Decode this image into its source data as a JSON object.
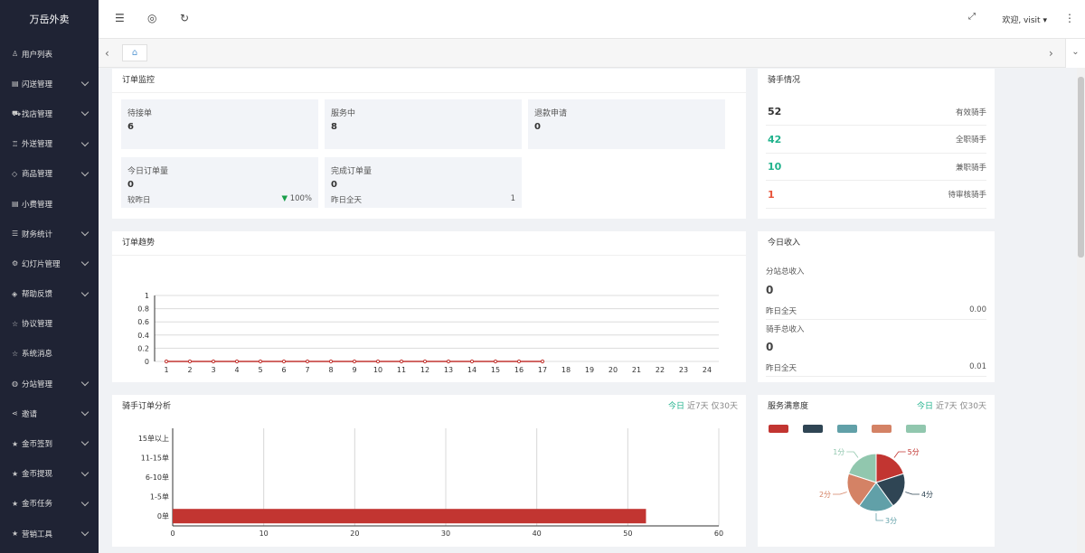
{
  "app": {
    "title": "万岳外卖"
  },
  "sidebar": {
    "items": [
      {
        "label": "用户列表",
        "icon": "user-icon",
        "glyph": "♙",
        "chevron": false
      },
      {
        "label": "闪送管理",
        "icon": "document-icon",
        "glyph": "▤",
        "chevron": true
      },
      {
        "label": "找店管理",
        "icon": "car-icon",
        "glyph": "⛟",
        "chevron": true
      },
      {
        "label": "外送管理",
        "icon": "courier-icon",
        "glyph": "♖",
        "chevron": true
      },
      {
        "label": "商品管理",
        "icon": "diamond-icon",
        "glyph": "◇",
        "chevron": true
      },
      {
        "label": "小费管理",
        "icon": "document-icon",
        "glyph": "▤",
        "chevron": false
      },
      {
        "label": "财务统计",
        "icon": "list-icon",
        "glyph": "☰",
        "chevron": true
      },
      {
        "label": "幻灯片管理",
        "icon": "gear-icon",
        "glyph": "⚙",
        "chevron": true
      },
      {
        "label": "帮助反馈",
        "icon": "layers-icon",
        "glyph": "◈",
        "chevron": true
      },
      {
        "label": "协议管理",
        "icon": "star-outline-icon",
        "glyph": "☆",
        "chevron": false
      },
      {
        "label": "系统消息",
        "icon": "star-outline-icon",
        "glyph": "☆",
        "chevron": false
      },
      {
        "label": "分站管理",
        "icon": "globe-icon",
        "glyph": "◍",
        "chevron": true
      },
      {
        "label": "邀请",
        "icon": "share-icon",
        "glyph": "⋖",
        "chevron": true
      },
      {
        "label": "金币签到",
        "icon": "star-icon",
        "glyph": "★",
        "chevron": true
      },
      {
        "label": "金币提现",
        "icon": "star-icon",
        "glyph": "★",
        "chevron": true
      },
      {
        "label": "金币任务",
        "icon": "star-icon",
        "glyph": "★",
        "chevron": true
      },
      {
        "label": "营销工具",
        "icon": "star-icon",
        "glyph": "★",
        "chevron": true
      }
    ]
  },
  "header": {
    "welcome": "欢迎, visit",
    "icons": [
      "menu-fold-icon",
      "globe-icon",
      "refresh-icon",
      "fullscreen-icon",
      "more-icon"
    ]
  },
  "order_monitor": {
    "title": "订单监控",
    "stats": [
      {
        "label": "待接单",
        "value": "6"
      },
      {
        "label": "服务中",
        "value": "8"
      },
      {
        "label": "退款申请",
        "value": "0"
      }
    ],
    "today": {
      "label": "今日订单量",
      "value": "0",
      "compare_label": "较昨日",
      "compare_value": "100%"
    },
    "completed": {
      "label": "完成订单量",
      "value": "0",
      "yesterday_label": "昨日全天",
      "yesterday_value": "1"
    }
  },
  "riders": {
    "title": "骑手情况",
    "rows": [
      {
        "count": "52",
        "label": "有效骑手",
        "color": "#333333"
      },
      {
        "count": "42",
        "label": "全职骑手",
        "color": "#20b28c"
      },
      {
        "count": "10",
        "label": "兼职骑手",
        "color": "#20b28c"
      },
      {
        "count": "1",
        "label": "待审核骑手",
        "color": "#e8543a"
      }
    ]
  },
  "income": {
    "title": "今日收入",
    "station_label": "分站总收入",
    "station_value": "0",
    "station_yesterday_label": "昨日全天",
    "station_yesterday_value": "0.00",
    "rider_label": "骑手总收入",
    "rider_value": "0",
    "rider_yesterday_label": "昨日全天",
    "rider_yesterday_value": "0.01"
  },
  "trend": {
    "title": "订单趋势"
  },
  "rider_orders": {
    "title": "骑手订单分析",
    "filters": [
      "今日",
      "近7天",
      "仅30天"
    ]
  },
  "satisfaction": {
    "title": "服务满意度",
    "filters": [
      "今日",
      "近7天",
      "仅30天"
    ]
  },
  "chart_data": [
    {
      "type": "line",
      "x": [
        "1",
        "2",
        "3",
        "4",
        "5",
        "6",
        "7",
        "8",
        "9",
        "10",
        "11",
        "12",
        "13",
        "14",
        "15",
        "16",
        "17",
        "18",
        "19",
        "20",
        "21",
        "22",
        "23",
        "24"
      ],
      "series": [
        {
          "values": [
            0,
            0,
            0,
            0,
            0,
            0,
            0,
            0,
            0,
            0,
            0,
            0,
            0,
            0,
            0,
            0,
            0
          ]
        }
      ],
      "yticks": [
        "0",
        "0.2",
        "0.4",
        "0.6",
        "0.8",
        "1"
      ],
      "ylim": [
        0,
        1
      ],
      "grid": true,
      "color": "#c23531"
    },
    {
      "type": "bar",
      "orientation": "horizontal",
      "categories": [
        "0单",
        "1-5单",
        "6-10单",
        "11-15单",
        "15单以上"
      ],
      "values": [
        52,
        0,
        0,
        0,
        0
      ],
      "xticks": [
        "0",
        "10",
        "20",
        "30",
        "40",
        "50",
        "60"
      ],
      "xlim": [
        0,
        60
      ],
      "grid": true,
      "color": "#c23531"
    },
    {
      "type": "pie",
      "legend": "top-left",
      "slices": [
        {
          "label": "5分",
          "value": 20,
          "color": "#c23531"
        },
        {
          "label": "4分",
          "value": 20,
          "color": "#2f4554"
        },
        {
          "label": "3分",
          "value": 20,
          "color": "#61a0a8"
        },
        {
          "label": "2分",
          "value": 20,
          "color": "#d48265"
        },
        {
          "label": "1分",
          "value": 20,
          "color": "#91c7ae"
        }
      ]
    }
  ]
}
